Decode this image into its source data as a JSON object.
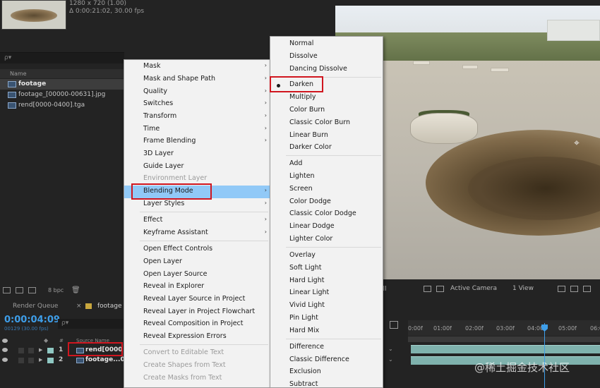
{
  "project": {
    "footage_resolution": "1280 x 720 (1.00)",
    "footage_duration": "Δ 0:00:21:02, 30.00 fps",
    "search_placeholder": "ρ▾",
    "name_column": "Name",
    "items": [
      {
        "label": "footage",
        "selected": true
      },
      {
        "label": "footage_[00000-00631].jpg",
        "selected": false
      },
      {
        "label": "rend[0000-0400].tga",
        "selected": false
      }
    ],
    "bit_depth": "8 bpc"
  },
  "viewer": {
    "camera": "Active Camera",
    "views": "1 View"
  },
  "timeline": {
    "tabs": {
      "render_queue": "Render Queue",
      "close": "×",
      "comp": "footage"
    },
    "timecode": "0:00:04:09",
    "frame_fps": "00129 (30.00 fps)",
    "search_placeholder": "ρ▾",
    "col_hash": "#",
    "col_source": "Source Name",
    "layers": [
      {
        "num": "1",
        "name": "rend[0000"
      },
      {
        "num": "2",
        "name": "footage...00"
      }
    ],
    "ruler_ticks": [
      "0:00f",
      "01:00f",
      "02:00f",
      "03:00f",
      "04:00f",
      "05:00f",
      "06:00f"
    ]
  },
  "main_menu": {
    "items": [
      {
        "label": "Mask",
        "submenu": true,
        "disabled": false
      },
      {
        "label": "Mask and Shape Path",
        "submenu": true,
        "disabled": false
      },
      {
        "label": "Quality",
        "submenu": true,
        "disabled": false
      },
      {
        "label": "Switches",
        "submenu": true,
        "disabled": false
      },
      {
        "label": "Transform",
        "submenu": true,
        "disabled": false
      },
      {
        "label": "Time",
        "submenu": true,
        "disabled": false
      },
      {
        "label": "Frame Blending",
        "submenu": true,
        "disabled": false
      },
      {
        "label": "3D Layer",
        "submenu": false,
        "disabled": false
      },
      {
        "label": "Guide Layer",
        "submenu": false,
        "disabled": false
      },
      {
        "label": "Environment Layer",
        "submenu": false,
        "disabled": true
      },
      {
        "label": "Blending Mode",
        "submenu": true,
        "disabled": false,
        "highlighted": true
      },
      {
        "label": "Layer Styles",
        "submenu": true,
        "disabled": false
      },
      {
        "label": "Effect",
        "submenu": true,
        "disabled": false
      },
      {
        "label": "Keyframe Assistant",
        "submenu": true,
        "disabled": false
      },
      {
        "label": "Open Effect Controls",
        "submenu": false,
        "disabled": false
      },
      {
        "label": "Open Layer",
        "submenu": false,
        "disabled": false
      },
      {
        "label": "Open Layer Source",
        "submenu": false,
        "disabled": false
      },
      {
        "label": "Reveal in Explorer",
        "submenu": false,
        "disabled": false
      },
      {
        "label": "Reveal Layer Source in Project",
        "submenu": false,
        "disabled": false
      },
      {
        "label": "Reveal Layer in Project Flowchart",
        "submenu": false,
        "disabled": false
      },
      {
        "label": "Reveal Composition in Project",
        "submenu": false,
        "disabled": false
      },
      {
        "label": "Reveal Expression Errors",
        "submenu": false,
        "disabled": false
      },
      {
        "label": "Convert to Editable Text",
        "submenu": false,
        "disabled": true
      },
      {
        "label": "Create Shapes from Text",
        "submenu": false,
        "disabled": true
      },
      {
        "label": "Create Masks from Text",
        "submenu": false,
        "disabled": true
      }
    ]
  },
  "blend_menu": {
    "items": [
      {
        "label": "Normal"
      },
      {
        "label": "Dissolve"
      },
      {
        "label": "Dancing Dissolve"
      },
      {
        "label": "Darken",
        "checked": true
      },
      {
        "label": "Multiply"
      },
      {
        "label": "Color Burn"
      },
      {
        "label": "Classic Color Burn"
      },
      {
        "label": "Linear Burn"
      },
      {
        "label": "Darker Color"
      },
      {
        "label": "Add"
      },
      {
        "label": "Lighten"
      },
      {
        "label": "Screen"
      },
      {
        "label": "Color Dodge"
      },
      {
        "label": "Classic Color Dodge"
      },
      {
        "label": "Linear Dodge"
      },
      {
        "label": "Lighter Color"
      },
      {
        "label": "Overlay"
      },
      {
        "label": "Soft Light"
      },
      {
        "label": "Hard Light"
      },
      {
        "label": "Linear Light"
      },
      {
        "label": "Vivid Light"
      },
      {
        "label": "Pin Light"
      },
      {
        "label": "Hard Mix"
      },
      {
        "label": "Difference"
      },
      {
        "label": "Classic Difference"
      },
      {
        "label": "Exclusion"
      },
      {
        "label": "Subtract"
      }
    ]
  },
  "watermark": "@稀土掘金技术社区",
  "colors": {
    "menu_highlight": "#91c9f7",
    "callout_red": "#d0161f",
    "timecode_blue": "#3e9ee9",
    "layer_label": "#8fc8c3"
  }
}
